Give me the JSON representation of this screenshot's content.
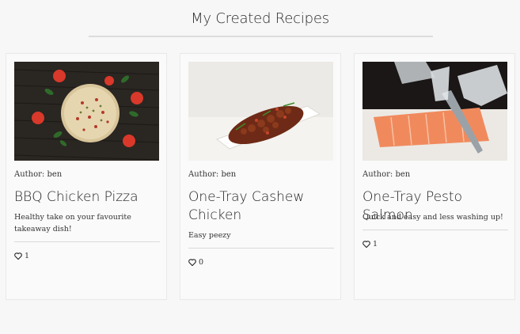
{
  "page": {
    "title": "My Created Recipes"
  },
  "recipes": [
    {
      "author": "Author: ben",
      "title": "BBQ Chicken Pizza",
      "description": "Healthy take on your favourite takeaway dish!",
      "likes": "1",
      "image": "pizza-photo"
    },
    {
      "author": "Author: ben",
      "title": "One-Tray Cashew Chicken",
      "description": "Easy peezy",
      "likes": "0",
      "image": "cashew-chicken-photo"
    },
    {
      "author": "Author: ben",
      "title": "One-Tray Pesto Salmon",
      "description": "Quick and easy and less washing up!",
      "likes": "1",
      "image": "salmon-photo"
    }
  ],
  "icons": {
    "like": "heart-icon"
  }
}
